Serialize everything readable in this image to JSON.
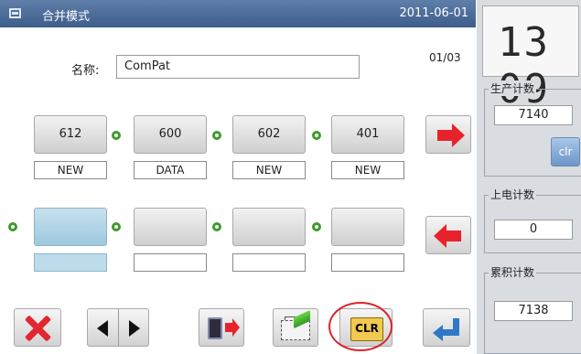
{
  "window": {
    "title": "合并模式",
    "date": "2011-06-01"
  },
  "page_indicator": "01/03",
  "name_field": {
    "label": "名称:",
    "value": "ComPat"
  },
  "patterns_row1": [
    {
      "number": "612",
      "label": "NEW"
    },
    {
      "number": "600",
      "label": "DATA"
    },
    {
      "number": "602",
      "label": "NEW"
    },
    {
      "number": "401",
      "label": "NEW"
    }
  ],
  "patterns_row2": [
    {
      "number": "",
      "label": ""
    },
    {
      "number": "",
      "label": ""
    },
    {
      "number": "",
      "label": ""
    },
    {
      "number": "",
      "label": ""
    }
  ],
  "bottom_toolbar": {
    "clr_label": "CLR"
  },
  "right_panel": {
    "clock": "13 09",
    "production_count": {
      "title": "生产计数",
      "value": "7140",
      "clr_label": "clr"
    },
    "power_on_count": {
      "title": "上电计数",
      "value": "0"
    },
    "cumulative_count": {
      "title": "累积计数",
      "value": "7138"
    }
  },
  "colors": {
    "titlebar": "#4a6a98",
    "accent_red": "#e8222c",
    "connector_green": "#3f9a2c",
    "selected_slot": "#9dc8de",
    "enter_blue": "#2f78c8"
  },
  "icons": [
    "window-icon",
    "arrow-right-icon",
    "arrow-left-icon",
    "close-icon",
    "prev-icon",
    "next-icon",
    "export-icon",
    "folder-icon",
    "clr-icon",
    "enter-icon"
  ]
}
